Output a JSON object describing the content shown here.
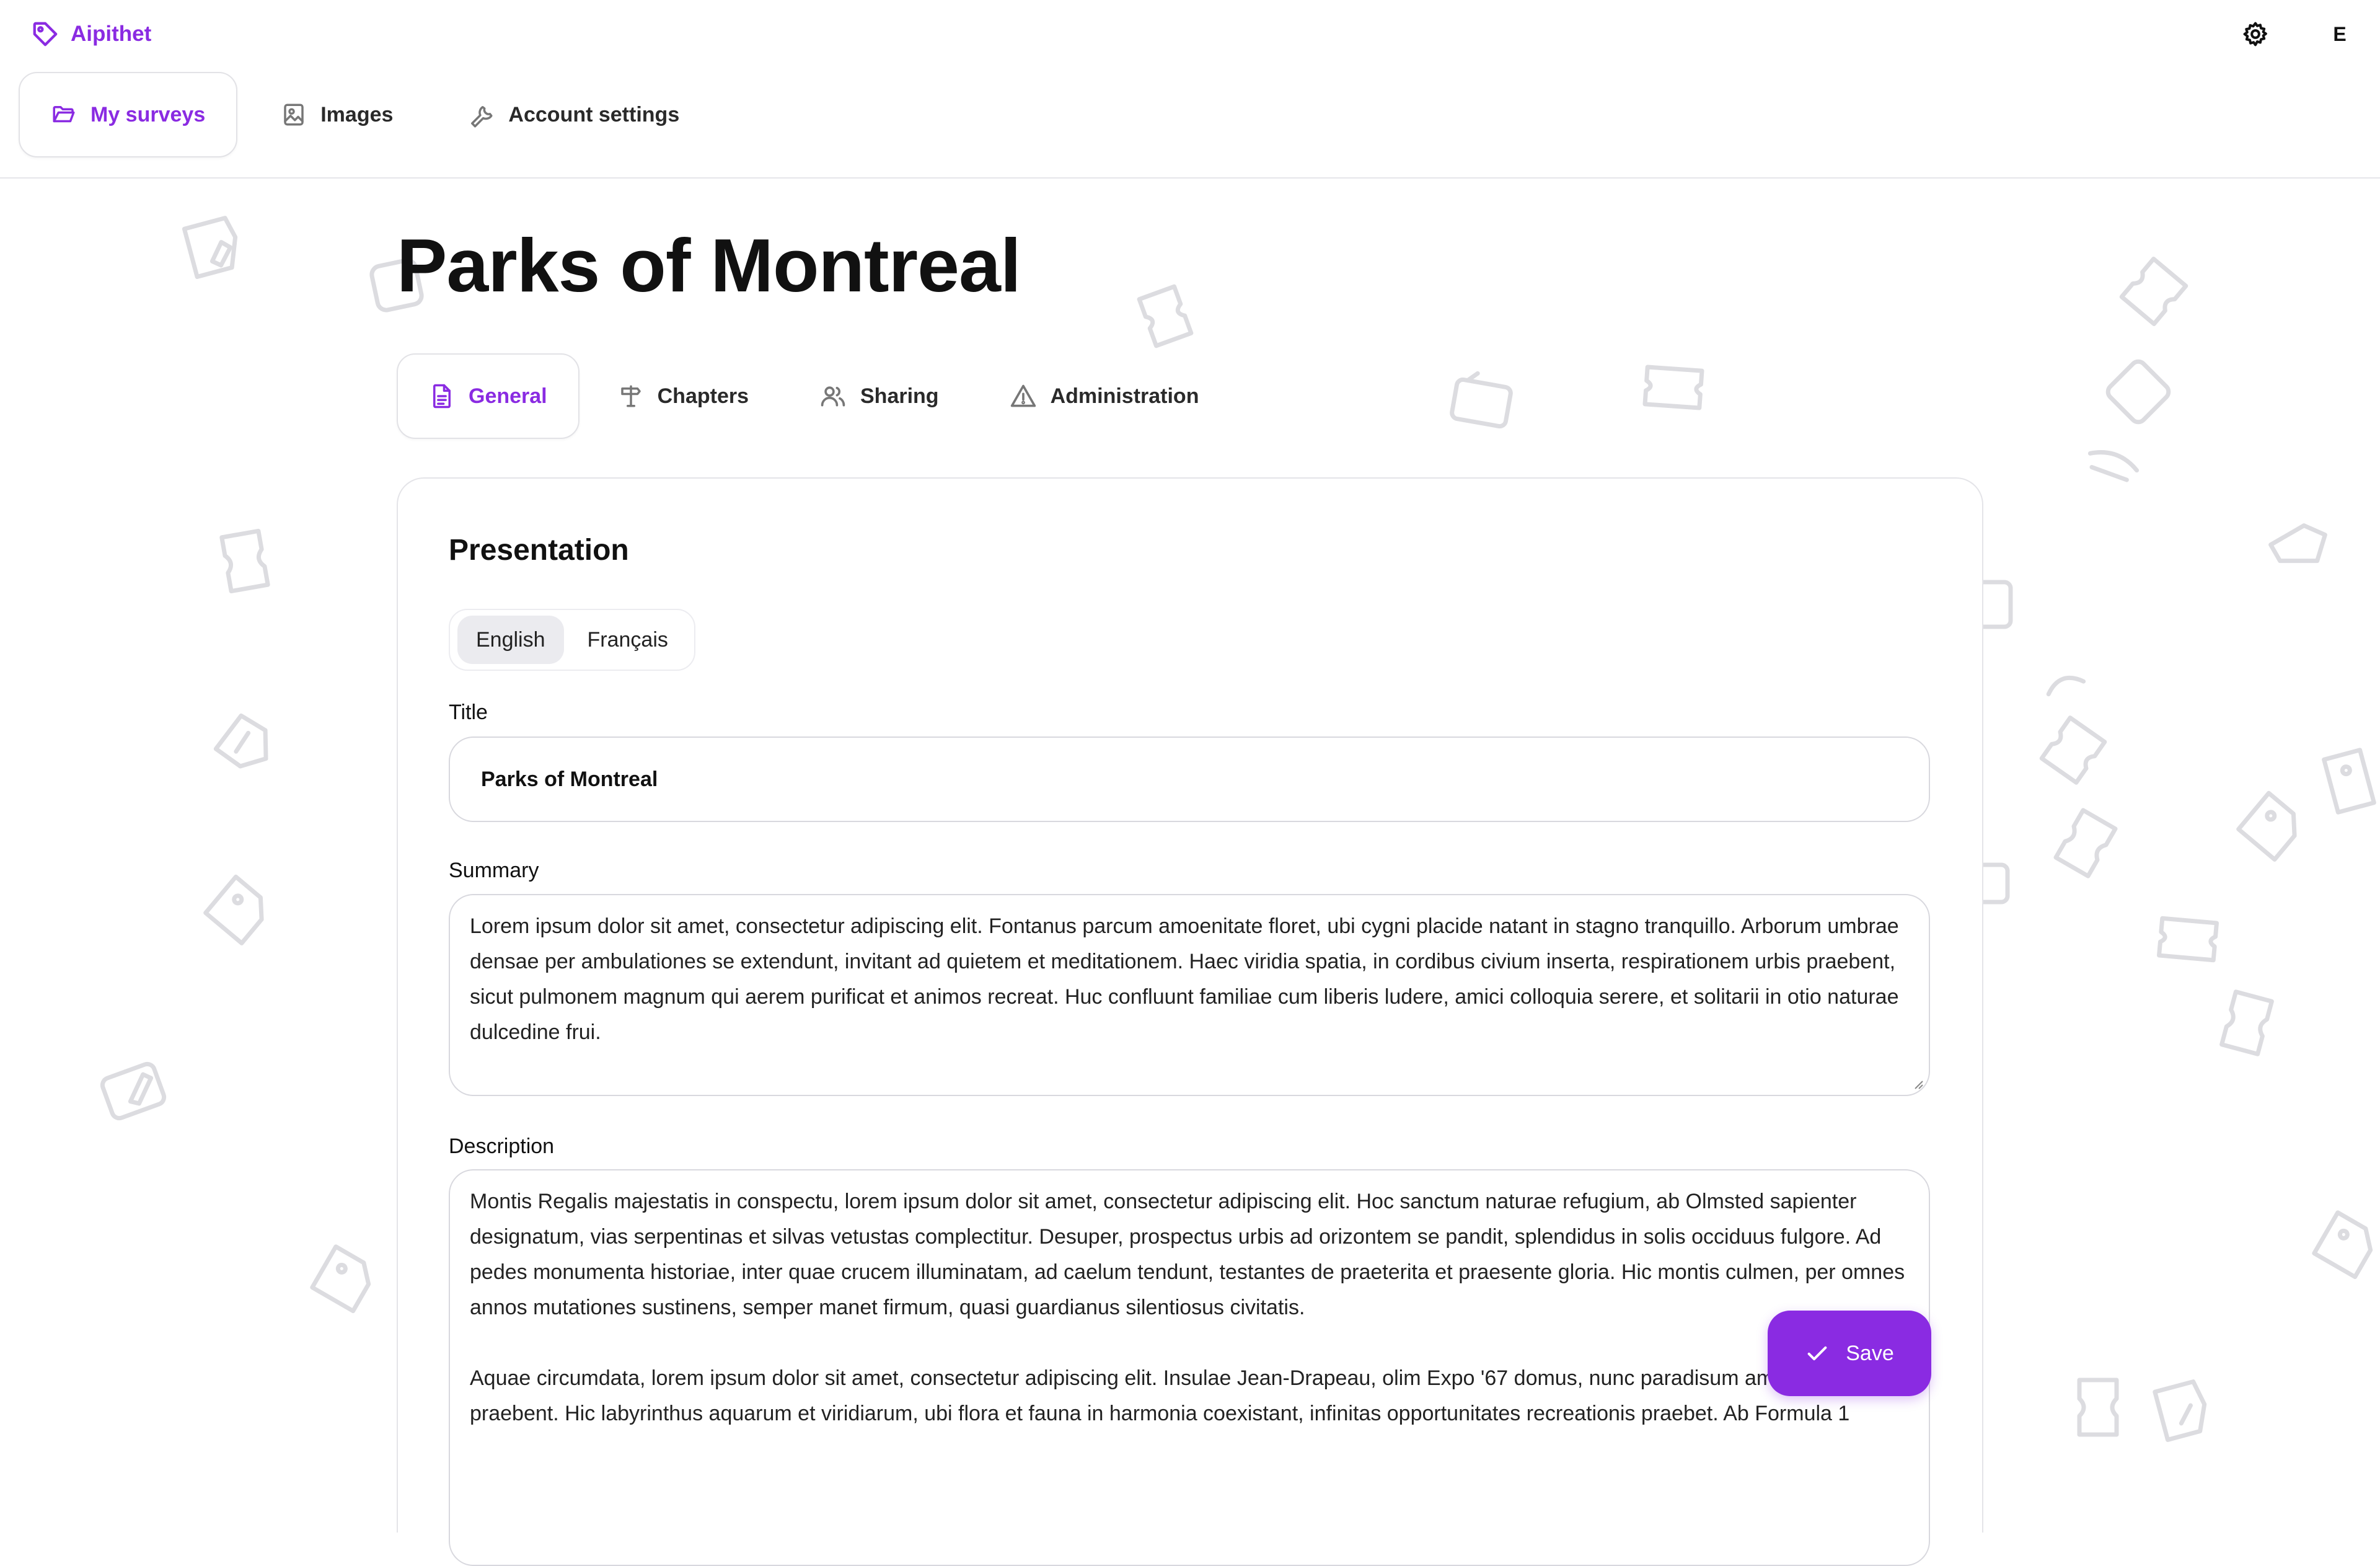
{
  "app": {
    "name": "Aipithet",
    "avatar_initial": "E"
  },
  "icons": {
    "brand": "tag-icon",
    "settings": "gear-icon",
    "my_surveys": "folder-open-icon",
    "images": "image-icon",
    "account_settings": "wrench-icon",
    "general": "document-icon",
    "chapters": "signpost-icon",
    "sharing": "users-icon",
    "administration": "warning-icon",
    "save": "check-icon"
  },
  "nav": {
    "items": [
      {
        "label": "My surveys",
        "active": true
      },
      {
        "label": "Images",
        "active": false
      },
      {
        "label": "Account settings",
        "active": false
      }
    ]
  },
  "page": {
    "title": "Parks of Montreal"
  },
  "tabs": [
    {
      "label": "General",
      "active": true
    },
    {
      "label": "Chapters",
      "active": false
    },
    {
      "label": "Sharing",
      "active": false
    },
    {
      "label": "Administration",
      "active": false
    }
  ],
  "presentation": {
    "heading": "Presentation",
    "languages": [
      {
        "label": "English",
        "active": true
      },
      {
        "label": "Français",
        "active": false
      }
    ],
    "title_label": "Title",
    "title_value": "Parks of Montreal",
    "summary_label": "Summary",
    "summary_value": "Lorem ipsum dolor sit amet, consectetur adipiscing elit. Fontanus parcum amoenitate floret, ubi cygni placide natant in stagno tranquillo. Arborum umbrae densae per ambulationes se extendunt, invitant ad quietem et meditationem. Haec viridia spatia, in cordibus civium inserta, respirationem urbis praebent, sicut pulmonem magnum qui aerem purificat et animos recreat. Huc confluunt familiae cum liberis ludere, amici colloquia serere, et solitarii in otio naturae dulcedine frui.",
    "description_label": "Description",
    "description_paragraphs": [
      "Montis Regalis majestatis in conspectu, lorem ipsum dolor sit amet, consectetur adipiscing elit. Hoc sanctum naturae refugium, ab Olmsted sapienter designatum, vias serpentinas et silvas vetustas complectitur. Desuper, prospectus urbis ad orizontem se pandit, splendidus in solis occiduus fulgore. Ad pedes monumenta historiae, inter quae crucem illuminatam, ad caelum tendunt, testantes de praeterita et praesente gloria. Hic montis culmen, per omnes annos mutationes sustinens, semper manet firmum, quasi guardianus silentiosus civitatis.",
      "Aquae circumdata, lorem ipsum dolor sit amet, consectetur adipiscing elit. Insulae Jean-Drapeau, olim Expo '67 domus, nunc paradisum amoenitatis praebent. Hic labyrinthus aquarum et viridiarum, ubi flora et fauna in harmonia coexistant, infinitas opportunitates recreationis praebet. Ab Formula 1"
    ]
  },
  "actions": {
    "save_label": "Save"
  },
  "colors": {
    "accent": "#8a2be2",
    "border": "#e2e2e6",
    "doodle": "#dcdce0"
  }
}
